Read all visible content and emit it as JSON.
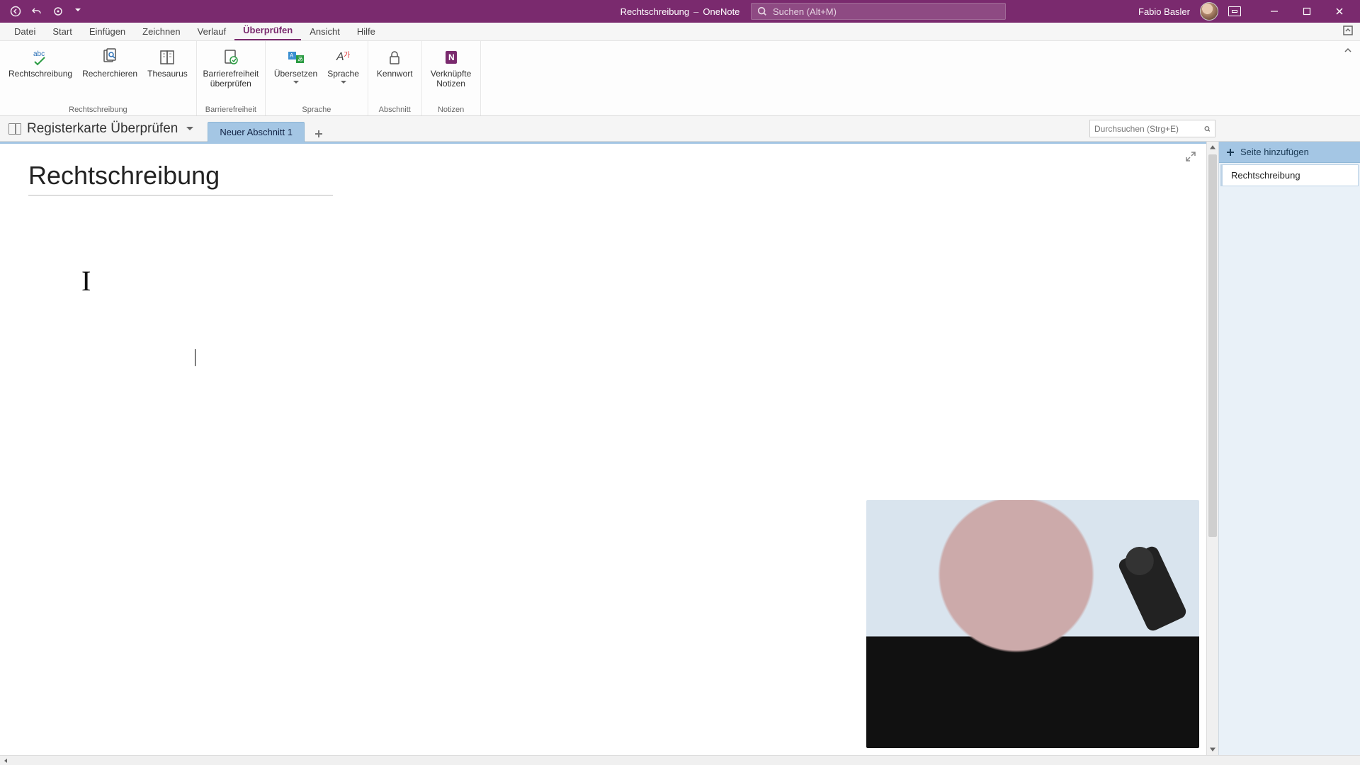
{
  "title": {
    "doc": "Rechtschreibung",
    "app": "OneNote"
  },
  "search": {
    "placeholder": "Suchen (Alt+M)"
  },
  "user": {
    "name": "Fabio Basler"
  },
  "menu": {
    "tabs": [
      "Datei",
      "Start",
      "Einfügen",
      "Zeichnen",
      "Verlauf",
      "Überprüfen",
      "Ansicht",
      "Hilfe"
    ],
    "active_index": 5
  },
  "ribbon": {
    "groups": [
      {
        "label": "Rechtschreibung",
        "buttons": [
          {
            "label": "Rechtschreibung",
            "icon": "abc-check-icon"
          },
          {
            "label": "Recherchieren",
            "icon": "research-icon"
          },
          {
            "label": "Thesaurus",
            "icon": "thesaurus-icon"
          }
        ]
      },
      {
        "label": "Barrierefreiheit",
        "buttons": [
          {
            "label": "Barrierefreiheit überprüfen",
            "icon": "accessibility-icon"
          }
        ]
      },
      {
        "label": "Sprache",
        "buttons": [
          {
            "label": "Übersetzen",
            "icon": "translate-icon",
            "dropdown": true
          },
          {
            "label": "Sprache",
            "icon": "language-icon",
            "dropdown": true
          }
        ]
      },
      {
        "label": "Abschnitt",
        "buttons": [
          {
            "label": "Kennwort",
            "icon": "lock-icon"
          }
        ]
      },
      {
        "label": "Notizen",
        "buttons": [
          {
            "label": "Verknüpfte Notizen",
            "icon": "linked-notes-icon"
          }
        ]
      }
    ]
  },
  "notebook": {
    "name": "Registerkarte Überprüfen",
    "sections": [
      {
        "label": "Neuer Abschnitt 1"
      }
    ],
    "search_placeholder": "Durchsuchen (Strg+E)"
  },
  "page": {
    "title": "Rechtschreibung",
    "body_sample": "I"
  },
  "pagelist": {
    "add_label": "Seite hinzufügen",
    "pages": [
      {
        "label": "Rechtschreibung"
      }
    ]
  }
}
